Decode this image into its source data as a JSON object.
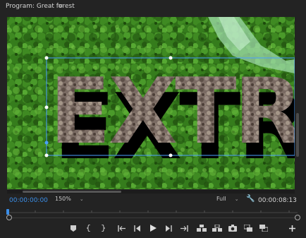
{
  "panel": {
    "title": "Program: Great forest",
    "menu_icon": "hamburger-menu-icon"
  },
  "viewer": {
    "overlay_text": "EXTR",
    "selection_color": "#4aa0ff"
  },
  "controls": {
    "current_time": "00:00:00:00",
    "zoom": "150%",
    "quality": "Full",
    "duration": "00:00:08:13"
  },
  "colors": {
    "accent": "#3b8ee8",
    "panel_bg": "#232323"
  },
  "transport": {
    "buttons": [
      "add-marker-icon",
      "mark-in-icon",
      "mark-out-icon",
      "go-to-in-icon",
      "step-back-icon",
      "play-icon",
      "step-forward-icon",
      "go-to-out-icon",
      "lift-icon",
      "extract-icon",
      "export-frame-icon",
      "comparison-view-icon",
      "toggle-proxies-icon",
      "add-button-icon"
    ]
  }
}
